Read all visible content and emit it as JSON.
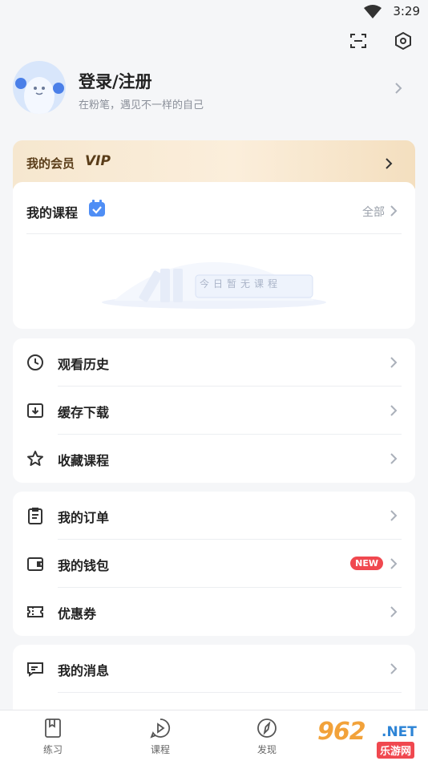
{
  "status": {
    "time": "3:29",
    "wifi_icon": "wifi-icon"
  },
  "top_actions": {
    "scan_icon": "scan-icon",
    "settings_icon": "settings-hexagon-icon"
  },
  "profile": {
    "name": "登录/注册",
    "subtitle": "在粉笔，遇见不一样的自己"
  },
  "vip": {
    "label": "我的会员",
    "tag": "VIP"
  },
  "courses": {
    "title": "我的课程",
    "all_label": "全部",
    "empty_text": "今日暂无课程"
  },
  "group1": [
    {
      "label": "观看历史",
      "icon": "clock-icon"
    },
    {
      "label": "缓存下载",
      "icon": "download-icon"
    },
    {
      "label": "收藏课程",
      "icon": "star-icon"
    }
  ],
  "group2": [
    {
      "label": "我的订单",
      "icon": "clipboard-icon"
    },
    {
      "label": "我的钱包",
      "icon": "wallet-icon",
      "badge": "NEW"
    },
    {
      "label": "优惠券",
      "icon": "coupon-icon"
    }
  ],
  "group3": [
    {
      "label": "我的消息",
      "icon": "message-icon"
    }
  ],
  "tabs": [
    {
      "label": "练习",
      "icon": "book-icon"
    },
    {
      "label": "课程",
      "icon": "play-chat-icon"
    },
    {
      "label": "发现",
      "icon": "compass-icon"
    }
  ],
  "watermark": {
    "logo": "962",
    "net": ".NET",
    "site": "乐游网"
  },
  "colors": {
    "accent_blue": "#3b82f6",
    "vip_gold": "#5a3d19",
    "badge_red": "#f0484f"
  }
}
